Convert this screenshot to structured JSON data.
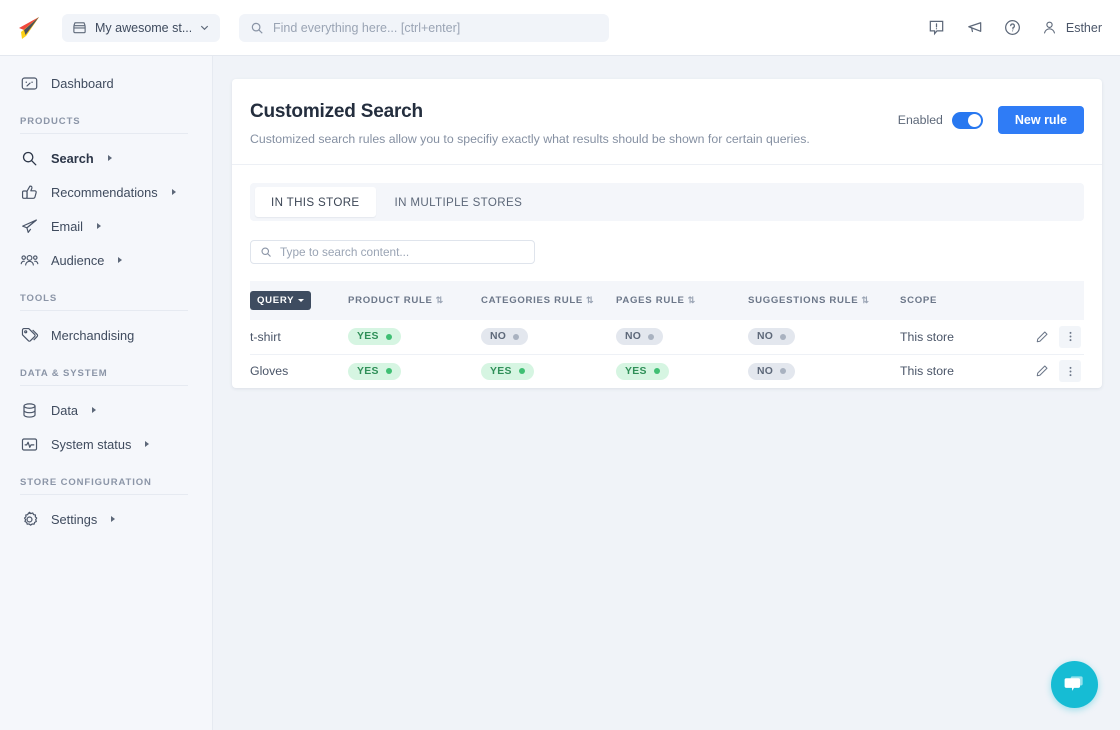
{
  "topbar": {
    "logo_icon": "paper-plane-logo",
    "store_selector": {
      "icon": "store-icon",
      "label": "My awesome st...",
      "caret": "chevron-down-icon"
    },
    "search": {
      "icon": "search-icon",
      "placeholder": "Find everything here... [ctrl+enter]",
      "value": ""
    },
    "icons": [
      "feedback-icon",
      "megaphone-icon",
      "help-icon"
    ],
    "user": {
      "icon": "user-avatar-icon",
      "name": "Esther"
    }
  },
  "sidebar": {
    "dashboard": {
      "label": "Dashboard",
      "icon": "dashboard-icon"
    },
    "sections": [
      {
        "title": "PRODUCTS",
        "items": [
          {
            "label": "Search",
            "icon": "search-icon",
            "expandable": true,
            "active": true
          },
          {
            "label": "Recommendations",
            "icon": "thumbs-up-icon",
            "expandable": true,
            "active": false
          },
          {
            "label": "Email",
            "icon": "email-plane-icon",
            "expandable": true,
            "active": false
          },
          {
            "label": "Audience",
            "icon": "audience-icon",
            "expandable": true,
            "active": false
          }
        ]
      },
      {
        "title": "TOOLS",
        "items": [
          {
            "label": "Merchandising",
            "icon": "tag-icon",
            "expandable": false,
            "active": false
          }
        ]
      },
      {
        "title": "DATA & SYSTEM",
        "items": [
          {
            "label": "Data",
            "icon": "database-icon",
            "expandable": true,
            "active": false
          },
          {
            "label": "System status",
            "icon": "pulse-icon",
            "expandable": true,
            "active": false
          }
        ]
      },
      {
        "title": "STORE CONFIGURATION",
        "items": [
          {
            "label": "Settings",
            "icon": "gear-icon",
            "expandable": true,
            "active": false
          }
        ]
      }
    ]
  },
  "main": {
    "title": "Customized Search",
    "subtitle": "Customized search rules allow you to specifiy exactly what results should be shown for certain queries.",
    "enabled_label": "Enabled",
    "enabled_state": true,
    "new_rule_label": "New rule",
    "tabs": [
      {
        "label": "IN THIS STORE",
        "active": true
      },
      {
        "label": "IN MULTIPLE STORES",
        "active": false
      }
    ],
    "table_search": {
      "icon": "search-icon",
      "placeholder": "Type to search content...",
      "value": ""
    },
    "table": {
      "columns": [
        {
          "label": "QUERY",
          "sorted": true,
          "sort_dir": "down"
        },
        {
          "label": "PRODUCT RULE",
          "sorted": false
        },
        {
          "label": "CATEGORIES RULE",
          "sorted": false
        },
        {
          "label": "PAGES RULE",
          "sorted": false
        },
        {
          "label": "SUGGESTIONS RULE",
          "sorted": false
        },
        {
          "label": "SCOPE",
          "sorted": false
        }
      ],
      "sort_icon": "⇅",
      "rows": [
        {
          "query": "t-shirt",
          "product_rule": "YES",
          "product_rule_on": true,
          "categories_rule": "NO",
          "categories_rule_on": false,
          "pages_rule": "NO",
          "pages_rule_on": false,
          "suggestions_rule": "NO",
          "suggestions_rule_on": false,
          "scope": "This store",
          "edit_icon": "pencil-icon",
          "more_icon": "kebab-menu-icon"
        },
        {
          "query": "Gloves",
          "product_rule": "YES",
          "product_rule_on": true,
          "categories_rule": "YES",
          "categories_rule_on": true,
          "pages_rule": "YES",
          "pages_rule_on": true,
          "suggestions_rule": "NO",
          "suggestions_rule_on": false,
          "scope": "This store",
          "edit_icon": "pencil-icon",
          "more_icon": "kebab-menu-icon"
        }
      ]
    }
  },
  "chat": {
    "icon": "chat-bubbles-icon",
    "color": "#16bcd4"
  },
  "colors": {
    "accent": "#2f7cf6",
    "page_bg": "#f0f3f8",
    "sidebar_bg": "#f5f7fb",
    "yes": "#3fbf73",
    "no": "#a9b2c0",
    "badge": "#3e4c60"
  }
}
